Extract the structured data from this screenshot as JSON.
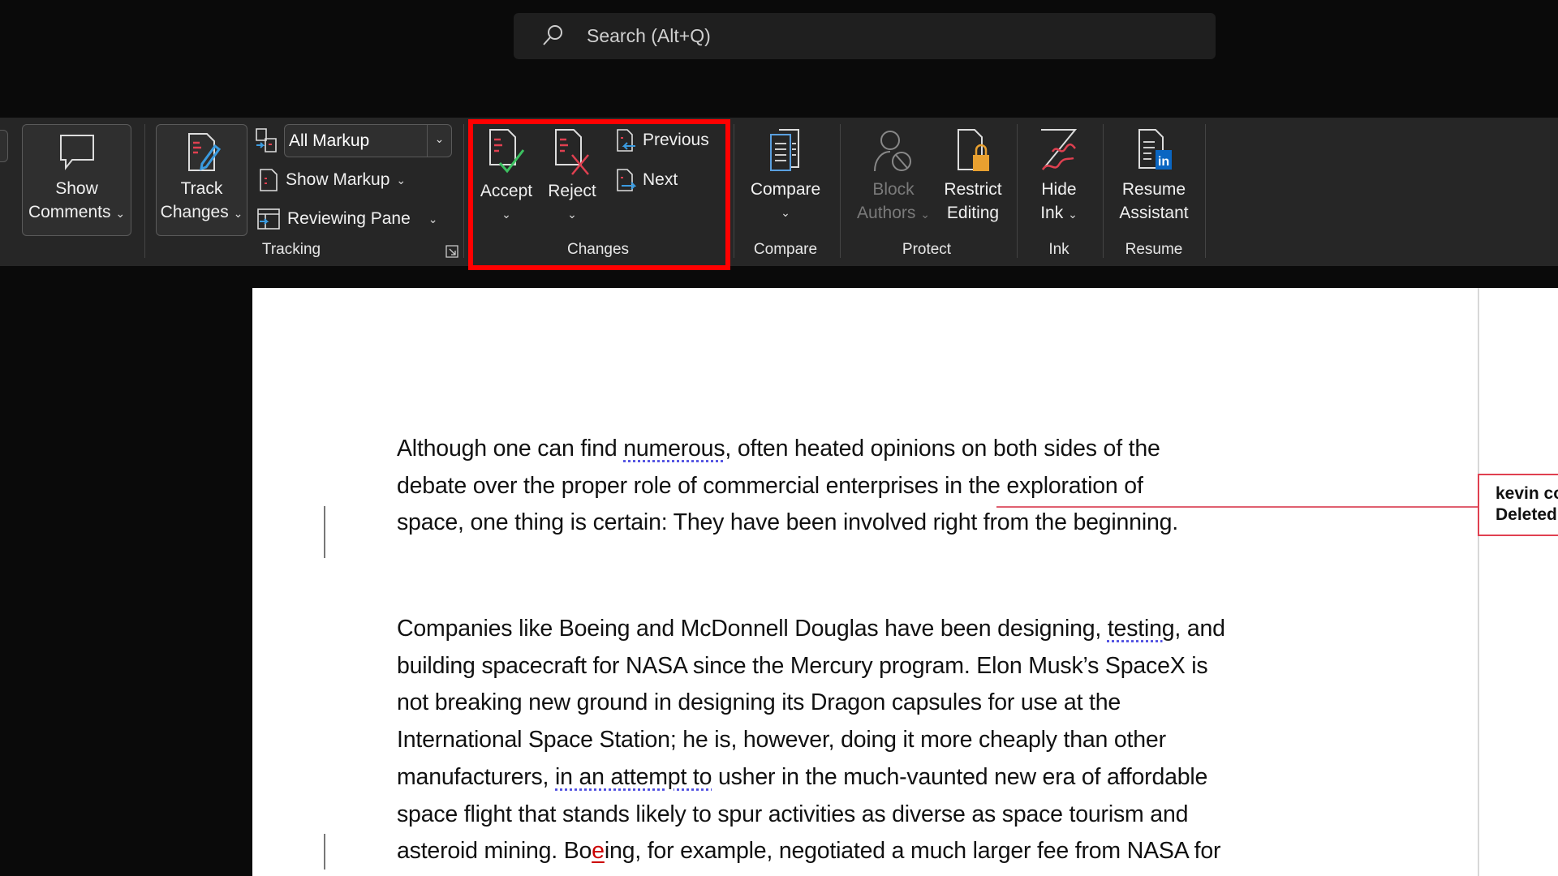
{
  "search": {
    "placeholder": "Search (Alt+Q)"
  },
  "ribbon": {
    "show_comments": {
      "line1": "Show",
      "line2": "Comments"
    },
    "track_changes": {
      "line1": "Track",
      "line2": "Changes"
    },
    "markup_select": "All Markup",
    "show_markup": "Show Markup",
    "reviewing_pane": "Reviewing Pane",
    "tracking_label": "Tracking",
    "accept": "Accept",
    "reject": "Reject",
    "previous": "Previous",
    "next": "Next",
    "changes_label": "Changes",
    "compare": "Compare",
    "compare_label": "Compare",
    "block_authors": {
      "line1": "Block",
      "line2": "Authors"
    },
    "restrict_editing": {
      "line1": "Restrict",
      "line2": "Editing"
    },
    "protect_label": "Protect",
    "hide_ink": {
      "line1": "Hide",
      "line2": "Ink"
    },
    "ink_label": "Ink",
    "resume_assistant": {
      "line1": "Resume",
      "line2": "Assistant"
    },
    "resume_label": "Resume",
    "highlight_color": "#ff0000"
  },
  "document": {
    "p1": [
      {
        "a": "Although one can find ",
        "u": "numerous",
        "b": ", often heated opinions on both sides of the"
      },
      {
        "a": "debate over the proper role of commercial enterprises in the exploration of"
      },
      {
        "a": "space, one thing is certain: They have been involved right from the beginning."
      }
    ],
    "p2": [
      {
        "a": "Companies like Boeing and McDonnell Douglas have been designing, ",
        "u": "testing",
        "b": ", and"
      },
      {
        "a": "building spacecraft for NASA since the Mercury program. Elon Musk’s SpaceX is"
      },
      {
        "a": "not breaking new ground in designing its Dragon capsules for use at the"
      },
      {
        "a": "International Space Station; he is, however, doing it more cheaply than other"
      },
      {
        "a": "manufacturers, ",
        "u": "in an attempt to",
        "b": " usher in the much-vaunted new era of affordable"
      },
      {
        "a": "space flight that stands likely to spur activities as diverse as space tourism and"
      },
      {
        "a": "asteroid mining. Bo",
        "ins": "e",
        "b": "ing, for example, negotiated a much larger fee from NASA for"
      }
    ]
  },
  "balloon": {
    "author": "kevin co",
    "action": "Deleted"
  }
}
